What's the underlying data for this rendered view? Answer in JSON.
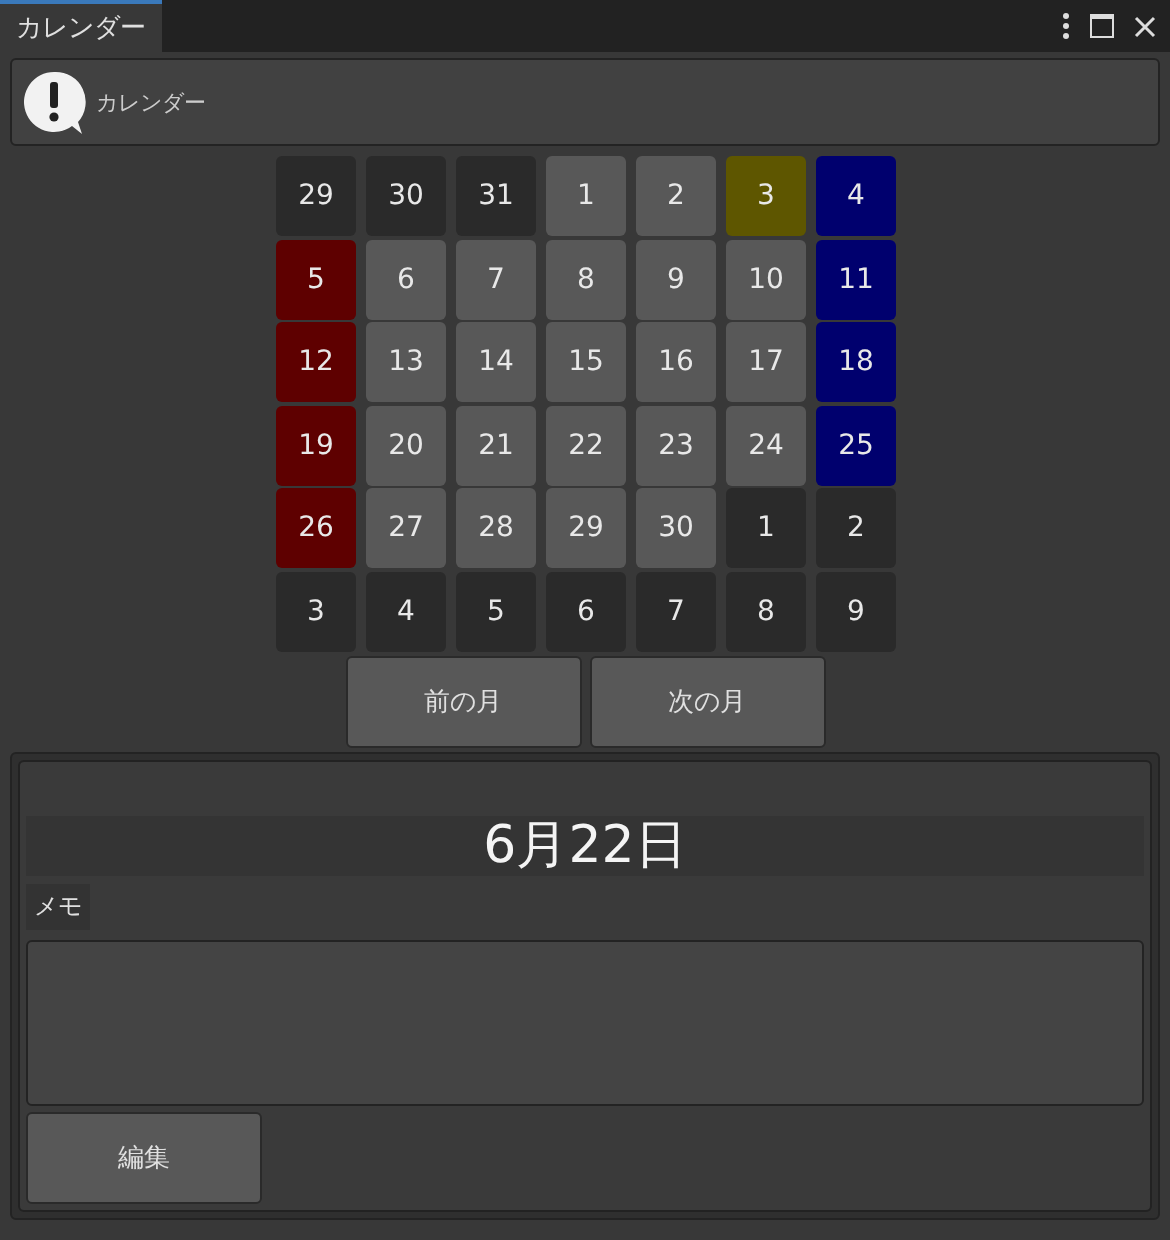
{
  "window": {
    "title": "カレンダー"
  },
  "header": {
    "label": "カレンダー"
  },
  "calendar": {
    "days": [
      {
        "label": "29",
        "kind": "other"
      },
      {
        "label": "30",
        "kind": "other"
      },
      {
        "label": "31",
        "kind": "other"
      },
      {
        "label": "1",
        "kind": "weekday"
      },
      {
        "label": "2",
        "kind": "weekday"
      },
      {
        "label": "3",
        "kind": "marked"
      },
      {
        "label": "4",
        "kind": "saturday"
      },
      {
        "label": "5",
        "kind": "sunday"
      },
      {
        "label": "6",
        "kind": "weekday"
      },
      {
        "label": "7",
        "kind": "weekday"
      },
      {
        "label": "8",
        "kind": "weekday"
      },
      {
        "label": "9",
        "kind": "weekday"
      },
      {
        "label": "10",
        "kind": "weekday"
      },
      {
        "label": "11",
        "kind": "saturday"
      },
      {
        "label": "12",
        "kind": "sunday"
      },
      {
        "label": "13",
        "kind": "weekday"
      },
      {
        "label": "14",
        "kind": "weekday"
      },
      {
        "label": "15",
        "kind": "weekday"
      },
      {
        "label": "16",
        "kind": "weekday"
      },
      {
        "label": "17",
        "kind": "weekday"
      },
      {
        "label": "18",
        "kind": "saturday"
      },
      {
        "label": "19",
        "kind": "sunday"
      },
      {
        "label": "20",
        "kind": "weekday"
      },
      {
        "label": "21",
        "kind": "weekday"
      },
      {
        "label": "22",
        "kind": "weekday"
      },
      {
        "label": "23",
        "kind": "weekday"
      },
      {
        "label": "24",
        "kind": "weekday"
      },
      {
        "label": "25",
        "kind": "saturday"
      },
      {
        "label": "26",
        "kind": "sunday"
      },
      {
        "label": "27",
        "kind": "weekday"
      },
      {
        "label": "28",
        "kind": "weekday"
      },
      {
        "label": "29",
        "kind": "weekday"
      },
      {
        "label": "30",
        "kind": "weekday"
      },
      {
        "label": "1",
        "kind": "other"
      },
      {
        "label": "2",
        "kind": "other"
      },
      {
        "label": "3",
        "kind": "other"
      },
      {
        "label": "4",
        "kind": "other"
      },
      {
        "label": "5",
        "kind": "other"
      },
      {
        "label": "6",
        "kind": "other"
      },
      {
        "label": "7",
        "kind": "other"
      },
      {
        "label": "8",
        "kind": "other"
      },
      {
        "label": "9",
        "kind": "other"
      }
    ],
    "buttons": [
      "前の月",
      "次の月"
    ]
  },
  "detail": {
    "date": "6月22日",
    "memo_label": "メモ",
    "edit_button": "編集"
  }
}
